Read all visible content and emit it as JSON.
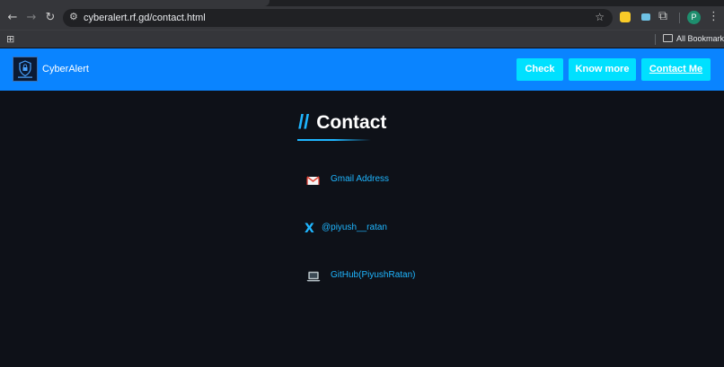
{
  "browser": {
    "url": "cyberalert.rf.gd/contact.html",
    "bookmarks_label": "All Bookmarks",
    "profile_initial": "P",
    "icons": {
      "back": "back-arrow-icon",
      "forward": "forward-arrow-icon",
      "reload": "reload-icon",
      "site_settings": "tune-icon",
      "bookmark_star": "star-icon",
      "extensions": "puzzle-icon",
      "menu": "kebab-menu-icon",
      "apps": "apps-grid-icon",
      "bookmarks_folder": "folder-icon"
    }
  },
  "nav": {
    "brand": "CyberAlert",
    "buttons": {
      "check": "Check",
      "know_more": "Know more",
      "contact": "Contact Me"
    },
    "colors": {
      "bar": "#0a84ff",
      "button": "#00e0ff"
    }
  },
  "page": {
    "heading_prefix": "//",
    "heading": "Contact",
    "contacts": [
      {
        "icon": "gmail-icon",
        "label": "Gmail Address"
      },
      {
        "icon": "x-icon",
        "label": "@piyush__ratan"
      },
      {
        "icon": "laptop-icon",
        "label": "GitHub(PiyushRatan)"
      }
    ],
    "colors": {
      "background": "#0e1118",
      "accent": "#1fb6ff"
    }
  }
}
